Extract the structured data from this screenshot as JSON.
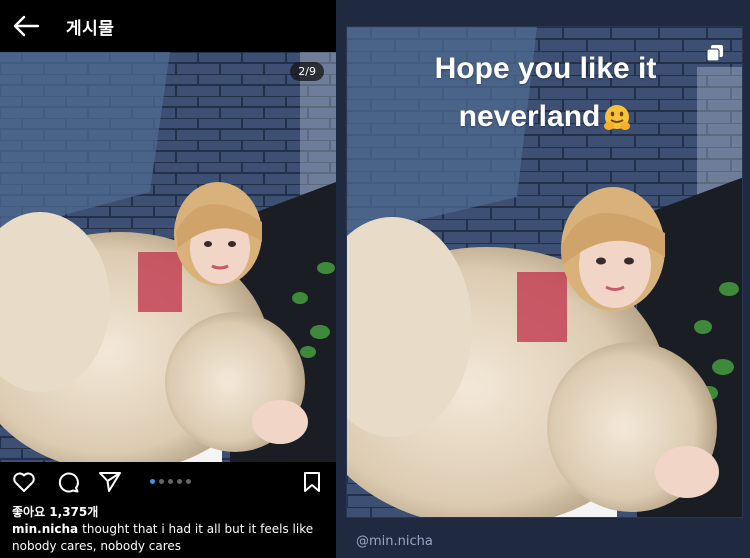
{
  "left": {
    "header": {
      "back_icon": "arrow-left-icon",
      "title": "게시물"
    },
    "photo": {
      "counter": "2/9"
    },
    "actions": {
      "like_icon": "heart-icon",
      "comment_icon": "comment-bubble-icon",
      "share_icon": "paper-plane-icon",
      "save_icon": "bookmark-icon",
      "carousel_total": 5,
      "carousel_active": 0
    },
    "likes": "좋아요 1,375개",
    "caption": {
      "username": "min.nicha",
      "text": "thought that i had it all but it feels like nobody cares, nobody cares"
    }
  },
  "right": {
    "story_text_line1": "Hope you like it",
    "story_text_line2": "neverland",
    "emoji": "hugging-face-emoji",
    "copy_icon": "square-copy-icon",
    "handle": "@min.nicha"
  },
  "colors": {
    "left_bg": "#000000",
    "right_bg": "#1f2a40",
    "accent": "#3897f0",
    "wall": "#3d4f72"
  }
}
